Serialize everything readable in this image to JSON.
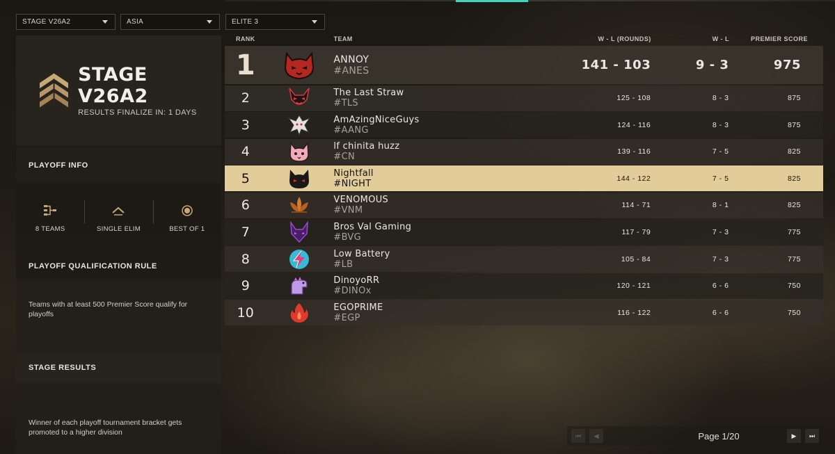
{
  "filters": {
    "stage": "STAGE V26A2",
    "region": "ASIA",
    "division": "ELITE 3"
  },
  "stage_card": {
    "title": "STAGE V26A2",
    "subtitle": "RESULTS FINALIZE IN: 1 DAYS",
    "icon": "rank-chevron-icon"
  },
  "playoff_info": {
    "heading": "PLAYOFF INFO",
    "stats": [
      {
        "icon": "bracket-icon",
        "label": "8 TEAMS"
      },
      {
        "icon": "chevron-up-icon",
        "label": "SINGLE ELIM"
      },
      {
        "icon": "circle-target-icon",
        "label": "BEST OF 1"
      }
    ]
  },
  "qualification": {
    "heading": "PLAYOFF QUALIFICATION RULE",
    "text": "Teams with at least 500 Premier Score qualify for playoffs"
  },
  "stage_results": {
    "heading": "STAGE RESULTS",
    "text": "Winner of each playoff tournament bracket gets promoted to a higher division"
  },
  "table": {
    "headers": {
      "rank": "RANK",
      "team": "TEAM",
      "wl_rounds": "W - L (ROUNDS)",
      "wl": "W - L",
      "score": "PREMIER SCORE"
    },
    "rows": [
      {
        "rank": "1",
        "name": "ANNOY",
        "tag": "#ANES",
        "wl_rounds": "141 - 103",
        "wl": "9 - 3",
        "score": "975",
        "logo": "red-cat-icon",
        "color": "#c8302a"
      },
      {
        "rank": "2",
        "name": "The Last Straw",
        "tag": "#TLS",
        "wl_rounds": "125 - 108",
        "wl": "8 - 3",
        "score": "875",
        "logo": "red-demon-icon",
        "color": "#d23a3a"
      },
      {
        "rank": "3",
        "name": "AmAzingNiceGuys",
        "tag": "#AANG",
        "wl_rounds": "124 - 116",
        "wl": "8 - 3",
        "score": "875",
        "logo": "white-dragon-icon",
        "color": "#d8d4cf"
      },
      {
        "rank": "4",
        "name": "lf chinita huzz",
        "tag": "#CN",
        "wl_rounds": "139 - 116",
        "wl": "7 - 5",
        "score": "825",
        "logo": "pink-cat-icon",
        "color": "#f0a6b8"
      },
      {
        "rank": "5",
        "name": "Nightfall",
        "tag": "#NIGHT",
        "wl_rounds": "144 - 122",
        "wl": "7 - 5",
        "score": "825",
        "logo": "black-cat-icon",
        "color": "#1a1818"
      },
      {
        "rank": "6",
        "name": "VENOMOUS",
        "tag": "#VNM",
        "wl_rounds": "114 - 71",
        "wl": "8 - 1",
        "score": "825",
        "logo": "orange-lotus-icon",
        "color": "#d27a2c"
      },
      {
        "rank": "7",
        "name": "Bros Val Gaming",
        "tag": "#BVG",
        "wl_rounds": "117 - 79",
        "wl": "7 - 3",
        "score": "775",
        "logo": "purple-wolf-icon",
        "color": "#7a3aa8"
      },
      {
        "rank": "8",
        "name": "Low Battery",
        "tag": "#LB",
        "wl_rounds": "105 - 84",
        "wl": "7 - 3",
        "score": "775",
        "logo": "lightning-icon",
        "color": "#3ab8d6"
      },
      {
        "rank": "9",
        "name": "DinoyoRR",
        "tag": "#DINOx",
        "wl_rounds": "120 - 121",
        "wl": "6 - 6",
        "score": "750",
        "logo": "purple-dino-icon",
        "color": "#b58be0"
      },
      {
        "rank": "10",
        "name": "EGOPRIME",
        "tag": "#EGP",
        "wl_rounds": "116 - 122",
        "wl": "6 - 6",
        "score": "750",
        "logo": "red-flame-icon",
        "color": "#e03a2c"
      }
    ]
  },
  "pager": {
    "label": "Page 1/20",
    "first_icon": "skip-first-icon",
    "prev_icon": "prev-icon",
    "next_icon": "next-icon",
    "last_icon": "skip-last-icon"
  },
  "colors": {
    "accent": "#3dd6c2",
    "highlight_row": "#e2cd9a"
  }
}
